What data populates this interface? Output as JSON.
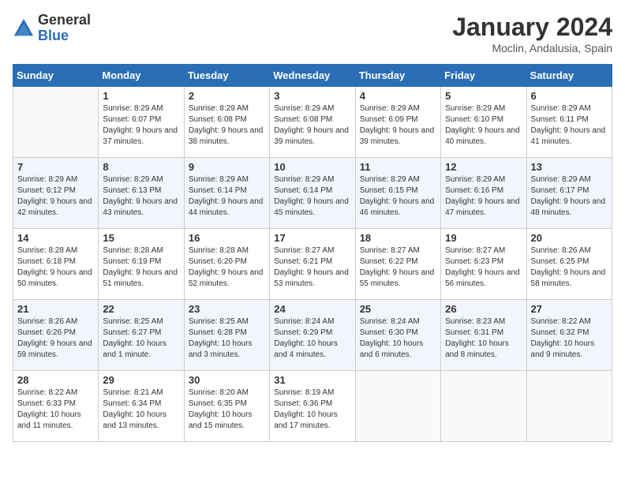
{
  "header": {
    "logo_general": "General",
    "logo_blue": "Blue",
    "title": "January 2024",
    "location": "Moclin, Andalusia, Spain"
  },
  "days_of_week": [
    "Sunday",
    "Monday",
    "Tuesday",
    "Wednesday",
    "Thursday",
    "Friday",
    "Saturday"
  ],
  "weeks": [
    [
      {
        "num": "",
        "empty": true
      },
      {
        "num": "1",
        "sunrise": "Sunrise: 8:29 AM",
        "sunset": "Sunset: 6:07 PM",
        "daylight": "Daylight: 9 hours and 37 minutes."
      },
      {
        "num": "2",
        "sunrise": "Sunrise: 8:29 AM",
        "sunset": "Sunset: 6:08 PM",
        "daylight": "Daylight: 9 hours and 38 minutes."
      },
      {
        "num": "3",
        "sunrise": "Sunrise: 8:29 AM",
        "sunset": "Sunset: 6:08 PM",
        "daylight": "Daylight: 9 hours and 39 minutes."
      },
      {
        "num": "4",
        "sunrise": "Sunrise: 8:29 AM",
        "sunset": "Sunset: 6:09 PM",
        "daylight": "Daylight: 9 hours and 39 minutes."
      },
      {
        "num": "5",
        "sunrise": "Sunrise: 8:29 AM",
        "sunset": "Sunset: 6:10 PM",
        "daylight": "Daylight: 9 hours and 40 minutes."
      },
      {
        "num": "6",
        "sunrise": "Sunrise: 8:29 AM",
        "sunset": "Sunset: 6:11 PM",
        "daylight": "Daylight: 9 hours and 41 minutes."
      }
    ],
    [
      {
        "num": "7",
        "sunrise": "Sunrise: 8:29 AM",
        "sunset": "Sunset: 6:12 PM",
        "daylight": "Daylight: 9 hours and 42 minutes."
      },
      {
        "num": "8",
        "sunrise": "Sunrise: 8:29 AM",
        "sunset": "Sunset: 6:13 PM",
        "daylight": "Daylight: 9 hours and 43 minutes."
      },
      {
        "num": "9",
        "sunrise": "Sunrise: 8:29 AM",
        "sunset": "Sunset: 6:14 PM",
        "daylight": "Daylight: 9 hours and 44 minutes."
      },
      {
        "num": "10",
        "sunrise": "Sunrise: 8:29 AM",
        "sunset": "Sunset: 6:14 PM",
        "daylight": "Daylight: 9 hours and 45 minutes."
      },
      {
        "num": "11",
        "sunrise": "Sunrise: 8:29 AM",
        "sunset": "Sunset: 6:15 PM",
        "daylight": "Daylight: 9 hours and 46 minutes."
      },
      {
        "num": "12",
        "sunrise": "Sunrise: 8:29 AM",
        "sunset": "Sunset: 6:16 PM",
        "daylight": "Daylight: 9 hours and 47 minutes."
      },
      {
        "num": "13",
        "sunrise": "Sunrise: 8:29 AM",
        "sunset": "Sunset: 6:17 PM",
        "daylight": "Daylight: 9 hours and 48 minutes."
      }
    ],
    [
      {
        "num": "14",
        "sunrise": "Sunrise: 8:28 AM",
        "sunset": "Sunset: 6:18 PM",
        "daylight": "Daylight: 9 hours and 50 minutes."
      },
      {
        "num": "15",
        "sunrise": "Sunrise: 8:28 AM",
        "sunset": "Sunset: 6:19 PM",
        "daylight": "Daylight: 9 hours and 51 minutes."
      },
      {
        "num": "16",
        "sunrise": "Sunrise: 8:28 AM",
        "sunset": "Sunset: 6:20 PM",
        "daylight": "Daylight: 9 hours and 52 minutes."
      },
      {
        "num": "17",
        "sunrise": "Sunrise: 8:27 AM",
        "sunset": "Sunset: 6:21 PM",
        "daylight": "Daylight: 9 hours and 53 minutes."
      },
      {
        "num": "18",
        "sunrise": "Sunrise: 8:27 AM",
        "sunset": "Sunset: 6:22 PM",
        "daylight": "Daylight: 9 hours and 55 minutes."
      },
      {
        "num": "19",
        "sunrise": "Sunrise: 8:27 AM",
        "sunset": "Sunset: 6:23 PM",
        "daylight": "Daylight: 9 hours and 56 minutes."
      },
      {
        "num": "20",
        "sunrise": "Sunrise: 8:26 AM",
        "sunset": "Sunset: 6:25 PM",
        "daylight": "Daylight: 9 hours and 58 minutes."
      }
    ],
    [
      {
        "num": "21",
        "sunrise": "Sunrise: 8:26 AM",
        "sunset": "Sunset: 6:26 PM",
        "daylight": "Daylight: 9 hours and 59 minutes."
      },
      {
        "num": "22",
        "sunrise": "Sunrise: 8:25 AM",
        "sunset": "Sunset: 6:27 PM",
        "daylight": "Daylight: 10 hours and 1 minute."
      },
      {
        "num": "23",
        "sunrise": "Sunrise: 8:25 AM",
        "sunset": "Sunset: 6:28 PM",
        "daylight": "Daylight: 10 hours and 3 minutes."
      },
      {
        "num": "24",
        "sunrise": "Sunrise: 8:24 AM",
        "sunset": "Sunset: 6:29 PM",
        "daylight": "Daylight: 10 hours and 4 minutes."
      },
      {
        "num": "25",
        "sunrise": "Sunrise: 8:24 AM",
        "sunset": "Sunset: 6:30 PM",
        "daylight": "Daylight: 10 hours and 6 minutes."
      },
      {
        "num": "26",
        "sunrise": "Sunrise: 8:23 AM",
        "sunset": "Sunset: 6:31 PM",
        "daylight": "Daylight: 10 hours and 8 minutes."
      },
      {
        "num": "27",
        "sunrise": "Sunrise: 8:22 AM",
        "sunset": "Sunset: 6:32 PM",
        "daylight": "Daylight: 10 hours and 9 minutes."
      }
    ],
    [
      {
        "num": "28",
        "sunrise": "Sunrise: 8:22 AM",
        "sunset": "Sunset: 6:33 PM",
        "daylight": "Daylight: 10 hours and 11 minutes."
      },
      {
        "num": "29",
        "sunrise": "Sunrise: 8:21 AM",
        "sunset": "Sunset: 6:34 PM",
        "daylight": "Daylight: 10 hours and 13 minutes."
      },
      {
        "num": "30",
        "sunrise": "Sunrise: 8:20 AM",
        "sunset": "Sunset: 6:35 PM",
        "daylight": "Daylight: 10 hours and 15 minutes."
      },
      {
        "num": "31",
        "sunrise": "Sunrise: 8:19 AM",
        "sunset": "Sunset: 6:36 PM",
        "daylight": "Daylight: 10 hours and 17 minutes."
      },
      {
        "num": "",
        "empty": true
      },
      {
        "num": "",
        "empty": true
      },
      {
        "num": "",
        "empty": true
      }
    ]
  ]
}
